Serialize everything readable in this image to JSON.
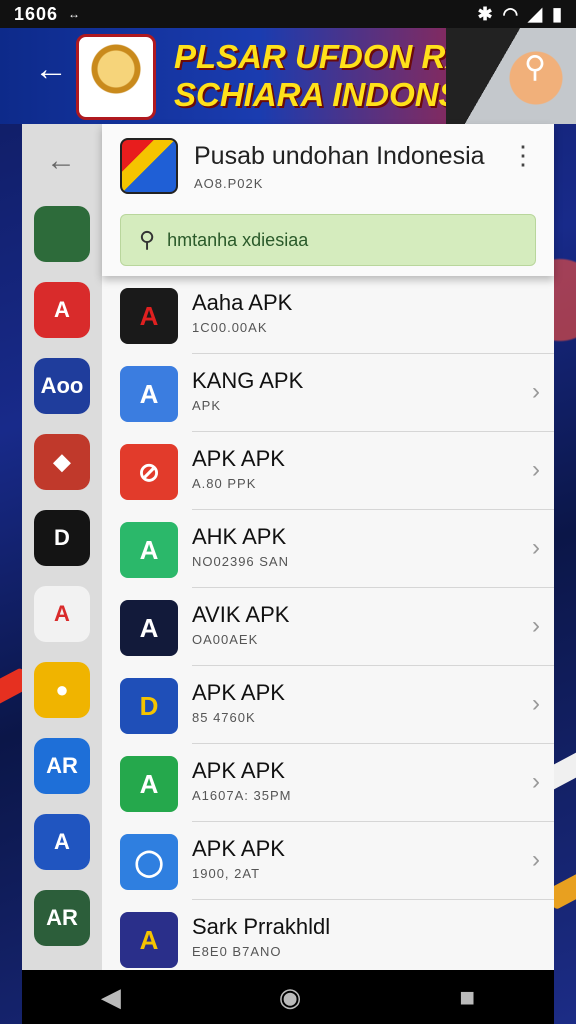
{
  "status_bar": {
    "time": "1606",
    "extra": "↔",
    "icons": [
      "bluetooth-icon",
      "wifi-icon",
      "signal-icon",
      "battery-icon"
    ]
  },
  "banner": {
    "title_line1": "PLSAR UFDON RAN",
    "title_line2": "SCHIARA INDONSIA"
  },
  "header": {
    "app_title": "Pusab undohan Indonesia",
    "app_subtitle": "AO8.P02K"
  },
  "search": {
    "value": "hmtanha xdiesiaa",
    "placeholder": "Search"
  },
  "rows": [
    {
      "name": "Aaha APK",
      "meta": "1C00.00AK",
      "icon": "A",
      "color": "#1a1a1a",
      "accent": "#e02020",
      "chevron": false
    },
    {
      "name": "KANG APK",
      "meta": "APK",
      "icon": "A",
      "color": "#3b7de0",
      "accent": "#ffffff",
      "chevron": true
    },
    {
      "name": "APK APK",
      "meta": "A.80 PPK",
      "icon": "⊘",
      "color": "#e23b2b",
      "accent": "#ffffff",
      "chevron": true
    },
    {
      "name": "AHK APK",
      "meta": "NO02396 SAN",
      "icon": "A",
      "color": "#2bb86a",
      "accent": "#ffffff",
      "chevron": true
    },
    {
      "name": "AVIK APK",
      "meta": "OA00AEK",
      "icon": "A",
      "color": "#121a3a",
      "accent": "#ffffff",
      "chevron": true
    },
    {
      "name": "APK APK",
      "meta": "85 4760K",
      "icon": "D",
      "color": "#1f4fb8",
      "accent": "#f5c400",
      "chevron": true
    },
    {
      "name": "APK APK",
      "meta": "A1607A: 35PM",
      "icon": "A",
      "color": "#25a84c",
      "accent": "#ffffff",
      "chevron": true
    },
    {
      "name": "APK APK",
      "meta": "1900, 2AT",
      "icon": "◯",
      "color": "#2f7fe0",
      "accent": "#ffffff",
      "chevron": true
    },
    {
      "name": "Sark Prrakhldl",
      "meta": "E8E0 B7ANO",
      "icon": "A",
      "color": "#2a2f8a",
      "accent": "#f5c400",
      "chevron": false
    }
  ],
  "rail_icons": [
    {
      "name": "emblem-app",
      "label": "",
      "color": "#2d6b3a"
    },
    {
      "name": "apk-red",
      "label": "A",
      "color": "#d92b2b"
    },
    {
      "name": "aaa-blue",
      "label": "Aoo",
      "color": "#1f3d9c"
    },
    {
      "name": "garuda",
      "label": "◆",
      "color": "#c0392b"
    },
    {
      "name": "dark-d",
      "label": "D",
      "color": "#141414"
    },
    {
      "name": "white-a",
      "label": "A",
      "color": "#f2f2f2"
    },
    {
      "name": "yellow-badge",
      "label": "●",
      "color": "#f0b400"
    },
    {
      "name": "ar-blue",
      "label": "AR",
      "color": "#1e6fd8"
    },
    {
      "name": "a-blue",
      "label": "A",
      "color": "#2055c0"
    },
    {
      "name": "ar-green",
      "label": "AR",
      "color": "#2c5e3a"
    }
  ]
}
